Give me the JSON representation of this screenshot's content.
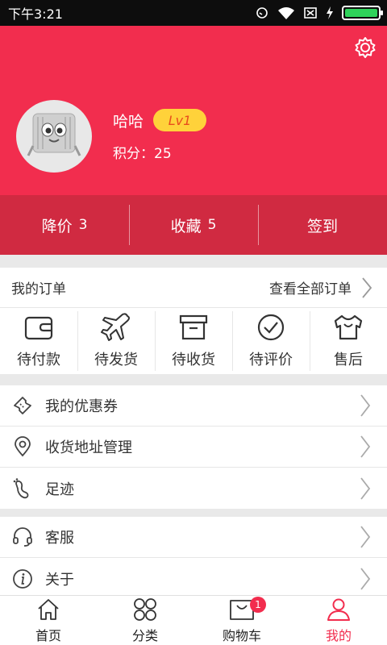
{
  "status_bar": {
    "time": "下午3:21"
  },
  "profile": {
    "username": "哈哈",
    "level": "Lv1",
    "points": "积分：25"
  },
  "stats": [
    {
      "label": "降价",
      "count": "3"
    },
    {
      "label": "收藏",
      "count": "5"
    },
    {
      "label": "签到",
      "count": ""
    }
  ],
  "orders": {
    "title": "我的订单",
    "view_all": "查看全部订单",
    "items": [
      {
        "label": "待付款",
        "icon": "wallet-icon"
      },
      {
        "label": "待发货",
        "icon": "airplane-icon"
      },
      {
        "label": "待收货",
        "icon": "box-icon"
      },
      {
        "label": "待评价",
        "icon": "check-circle-icon"
      },
      {
        "label": "售后",
        "icon": "shirt-icon"
      }
    ]
  },
  "menu_group_1": [
    {
      "label": "我的优惠券",
      "icon": "ticket-icon"
    },
    {
      "label": "收货地址管理",
      "icon": "location-pin-icon"
    },
    {
      "label": "足迹",
      "icon": "footprint-icon"
    }
  ],
  "menu_group_2": [
    {
      "label": "客服",
      "icon": "headset-icon"
    },
    {
      "label": "关于",
      "icon": "info-icon"
    }
  ],
  "bottom_nav": {
    "items": [
      {
        "label": "首页",
        "icon": "home-icon"
      },
      {
        "label": "分类",
        "icon": "grid-icon"
      },
      {
        "label": "购物车",
        "icon": "cart-icon"
      },
      {
        "label": "我的",
        "icon": "user-icon"
      }
    ],
    "cart_badge": "1",
    "active": "我的"
  },
  "colors": {
    "brand": "#f22d4e",
    "stats_bg": "#d02a41",
    "badge": "#ffd23a"
  }
}
